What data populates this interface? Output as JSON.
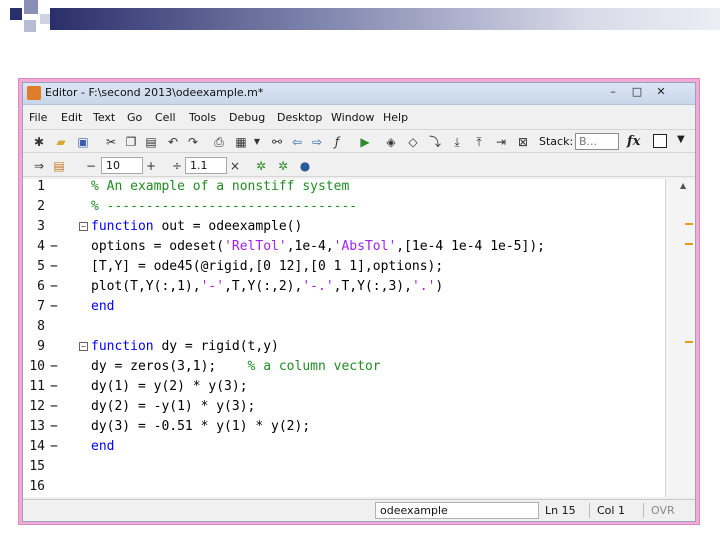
{
  "window": {
    "title": "Editor - F:\\second 2013\\odeexample.m*",
    "minimize": "–",
    "maximize": "□",
    "close": "✕"
  },
  "menu": [
    "File",
    "Edit",
    "Text",
    "Go",
    "Cell",
    "Tools",
    "Debug",
    "Desktop",
    "Window",
    "Help"
  ],
  "toolbar": {
    "stack_label": "Stack:",
    "stack_value": "B...",
    "fx": "fx"
  },
  "cellbar": {
    "minus": "−",
    "value1": "10",
    "plus": "+",
    "divide": "÷",
    "value2": "1.1",
    "times": "×"
  },
  "code_lines": [
    {
      "n": "1",
      "dash": "",
      "fold": "",
      "parts": [
        {
          "t": "% An example of a nonstiff system",
          "c": "com"
        }
      ]
    },
    {
      "n": "2",
      "dash": "",
      "fold": "",
      "parts": [
        {
          "t": "% --------------------------------",
          "c": "com"
        }
      ]
    },
    {
      "n": "3",
      "dash": "",
      "fold": "−",
      "parts": [
        {
          "t": "function",
          "c": "kw"
        },
        {
          "t": " out = odeexample()",
          "c": ""
        }
      ]
    },
    {
      "n": "4",
      "dash": "−",
      "fold": "",
      "parts": [
        {
          "t": "options = odeset(",
          "c": ""
        },
        {
          "t": "'RelTol'",
          "c": "str"
        },
        {
          "t": ",1e-4,",
          "c": ""
        },
        {
          "t": "'AbsTol'",
          "c": "str"
        },
        {
          "t": ",[1e-4 1e-4 1e-5]);",
          "c": ""
        }
      ]
    },
    {
      "n": "5",
      "dash": "−",
      "fold": "",
      "parts": [
        {
          "t": "[T,Y] = ode45(@rigid,[0 12],[0 1 1],options);",
          "c": ""
        }
      ]
    },
    {
      "n": "6",
      "dash": "−",
      "fold": "",
      "parts": [
        {
          "t": "plot(T,Y(:,1),",
          "c": ""
        },
        {
          "t": "'-'",
          "c": "str"
        },
        {
          "t": ",T,Y(:,2),",
          "c": ""
        },
        {
          "t": "'-.'",
          "c": "str"
        },
        {
          "t": ",T,Y(:,3),",
          "c": ""
        },
        {
          "t": "'.'",
          "c": "str"
        },
        {
          "t": ")",
          "c": ""
        }
      ]
    },
    {
      "n": "7",
      "dash": "−",
      "fold": "",
      "parts": [
        {
          "t": "end",
          "c": "kw"
        }
      ]
    },
    {
      "n": "8",
      "dash": "",
      "fold": "",
      "parts": []
    },
    {
      "n": "9",
      "dash": "",
      "fold": "−",
      "parts": [
        {
          "t": "function",
          "c": "kw"
        },
        {
          "t": " dy = rigid(t,y)",
          "c": ""
        }
      ]
    },
    {
      "n": "10",
      "dash": "−",
      "fold": "",
      "parts": [
        {
          "t": "dy = zeros(3,1);    ",
          "c": ""
        },
        {
          "t": "% a column vector",
          "c": "com"
        }
      ]
    },
    {
      "n": "11",
      "dash": "−",
      "fold": "",
      "parts": [
        {
          "t": "dy(1) = y(2) * y(3);",
          "c": ""
        }
      ]
    },
    {
      "n": "12",
      "dash": "−",
      "fold": "",
      "parts": [
        {
          "t": "dy(2) = -y(1) * y(3);",
          "c": ""
        }
      ]
    },
    {
      "n": "13",
      "dash": "−",
      "fold": "",
      "parts": [
        {
          "t": "dy(3) = -0.51 * y(1) * y(2);",
          "c": ""
        }
      ]
    },
    {
      "n": "14",
      "dash": "−",
      "fold": "",
      "parts": [
        {
          "t": "end",
          "c": "kw"
        }
      ]
    },
    {
      "n": "15",
      "dash": "",
      "fold": "",
      "parts": []
    },
    {
      "n": "16",
      "dash": "",
      "fold": "",
      "parts": []
    }
  ],
  "status": {
    "function_name": "odeexample",
    "ln": "Ln  15",
    "col": "Col  1",
    "ovr": "OVR"
  },
  "colors": {
    "keyword": "#0000ff",
    "string": "#a020f0",
    "comment": "#228b22",
    "slide_frame": "#f2a8d8"
  }
}
